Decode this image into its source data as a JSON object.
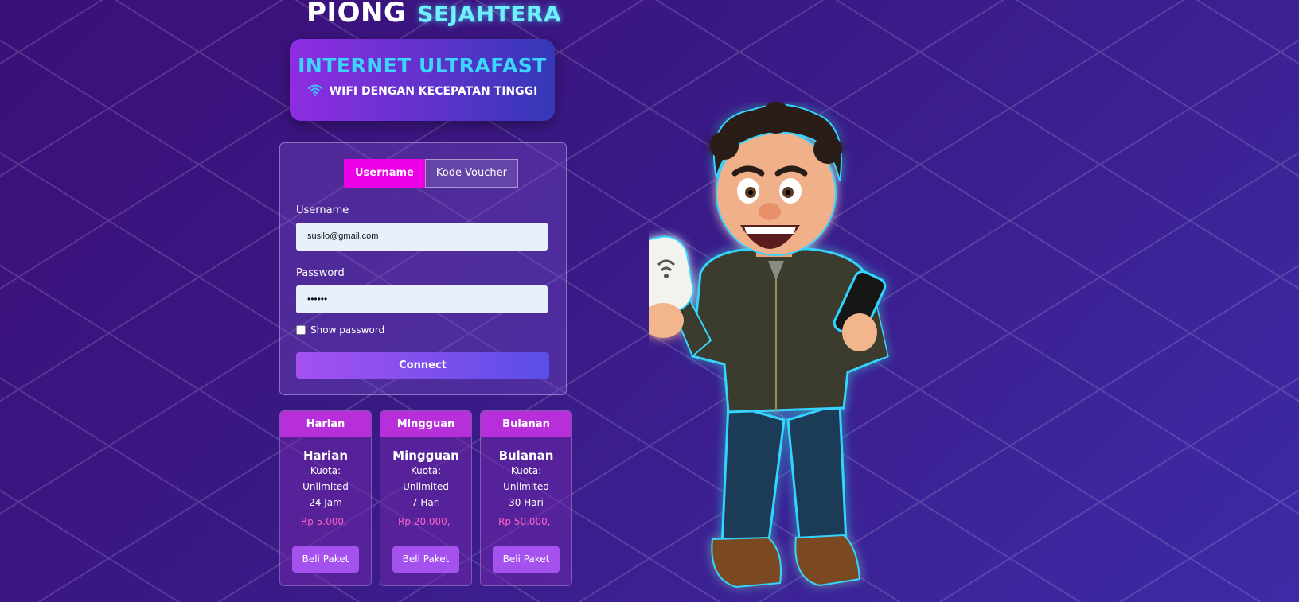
{
  "brand": {
    "word1": "PIONG",
    "word2": "SEJAHTERA"
  },
  "hero": {
    "title": "INTERNET ULTRAFAST",
    "subtitle": "WIFI DENGAN KECEPATAN TINGGI",
    "icon": "wifi-icon"
  },
  "login": {
    "tabs": [
      {
        "label": "Username",
        "active": true
      },
      {
        "label": "Kode Voucher",
        "active": false
      }
    ],
    "username_label": "Username",
    "username_value": "susilo@gmail.com",
    "password_label": "Password",
    "password_value": "••••••",
    "show_password_label": "Show password",
    "connect_label": "Connect"
  },
  "packages": [
    {
      "header": "Harian",
      "name": "Harian",
      "quota_label": "Kuota:",
      "quota": "Unlimited",
      "duration": "24 Jam",
      "price": "Rp 5.000,-",
      "button": "Beli Paket"
    },
    {
      "header": "Mingguan",
      "name": "Mingguan",
      "quota_label": "Kuota:",
      "quota": "Unlimited",
      "duration": "7 Hari",
      "price": "Rp 20.000,-",
      "button": "Beli Paket"
    },
    {
      "header": "Bulanan",
      "name": "Bulanan",
      "quota_label": "Kuota:",
      "quota": "Unlimited",
      "duration": "30 Hari",
      "price": "Rp 50.000,-",
      "button": "Beli Paket"
    }
  ],
  "colors": {
    "accent_tab": "#ee00e6",
    "hero_title": "#39d7ff",
    "price": "#ff5fc8",
    "button": "#a451ee"
  }
}
